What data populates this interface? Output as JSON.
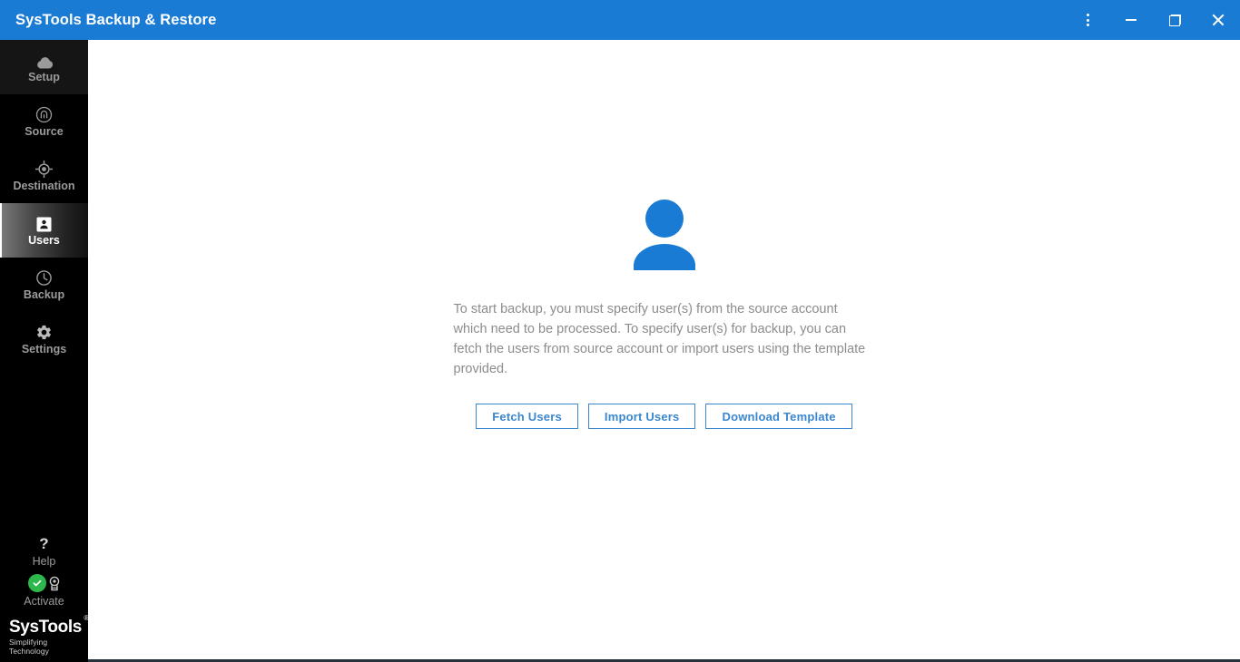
{
  "window": {
    "title": "SysTools Backup & Restore",
    "controls": [
      {
        "name": "menu-button",
        "icon": "kebab-menu-icon"
      },
      {
        "name": "minimize-button",
        "icon": "minimize-icon"
      },
      {
        "name": "restore-button",
        "icon": "restore-window-icon"
      },
      {
        "name": "close-button",
        "icon": "close-icon"
      }
    ],
    "titlebar_color": "#1a7bd4"
  },
  "sidebar": {
    "items": [
      {
        "label": "Setup",
        "icon": "cloud-icon",
        "active": false
      },
      {
        "label": "Source",
        "icon": "source-arch-icon",
        "active": false
      },
      {
        "label": "Destination",
        "icon": "crosshair-icon",
        "active": false
      },
      {
        "label": "Users",
        "icon": "user-card-icon",
        "active": true
      },
      {
        "label": "Backup",
        "icon": "clock-icon",
        "active": false
      },
      {
        "label": "Settings",
        "icon": "gear-icon",
        "active": false
      }
    ],
    "utilities": [
      {
        "label": "Help",
        "icon": "question-mark-icon"
      },
      {
        "label": "Activate",
        "icon": "medal-icon",
        "badge": "check-circle-icon",
        "badge_color": "#2db84c"
      }
    ],
    "brand": {
      "name": "SysTools",
      "registered": "®",
      "tagline": "Simplifying Technology"
    },
    "background_color": "#000000",
    "active_text_color": "#ffffff",
    "inactive_text_color": "#9b9b9b"
  },
  "main": {
    "hero_icon": "user-avatar-icon",
    "hero_icon_color": "#1a7bd4",
    "description": "To start backup, you must specify user(s) from the source account which need to be processed. To specify user(s) for backup, you can fetch the users from source account or import users using the template provided.",
    "buttons": [
      {
        "label": "Fetch Users",
        "name": "fetch-users-button"
      },
      {
        "label": "Import Users",
        "name": "import-users-button"
      },
      {
        "label": "Download Template",
        "name": "download-template-button"
      }
    ],
    "accent_color": "#3a86cf"
  }
}
